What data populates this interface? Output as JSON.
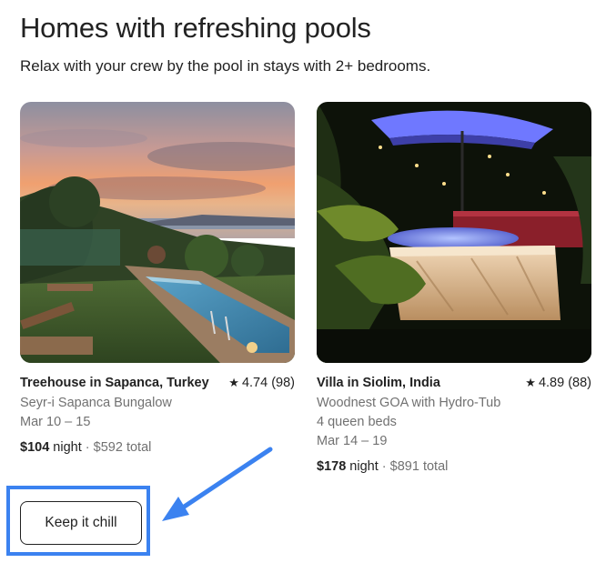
{
  "section": {
    "title": "Homes with refreshing pools",
    "subtitle": "Relax with your crew by the pool in stays with 2+ bedrooms."
  },
  "listings": [
    {
      "title": "Treehouse in Sapanca, Turkey",
      "rating_icon": "star-icon",
      "rating": "4.74 (98)",
      "lines": [
        "Seyr-i Sapanca Bungalow",
        "Mar 10 – 15"
      ],
      "price": "$104",
      "price_unit": "night",
      "separator": "·",
      "total": "$592 total"
    },
    {
      "title": "Villa in Siolim, India",
      "rating_icon": "star-icon",
      "rating": "4.89 (88)",
      "lines": [
        "Woodnest GOA with Hydro-Tub",
        "4 queen beds",
        "Mar 14 – 19"
      ],
      "price": "$178",
      "price_unit": "night",
      "separator": "·",
      "total": "$891 total"
    }
  ],
  "cta": {
    "label": "Keep it chill"
  },
  "colors": {
    "text_primary": "#222222",
    "text_secondary": "#717171",
    "annotation_blue": "#3b82f0"
  }
}
